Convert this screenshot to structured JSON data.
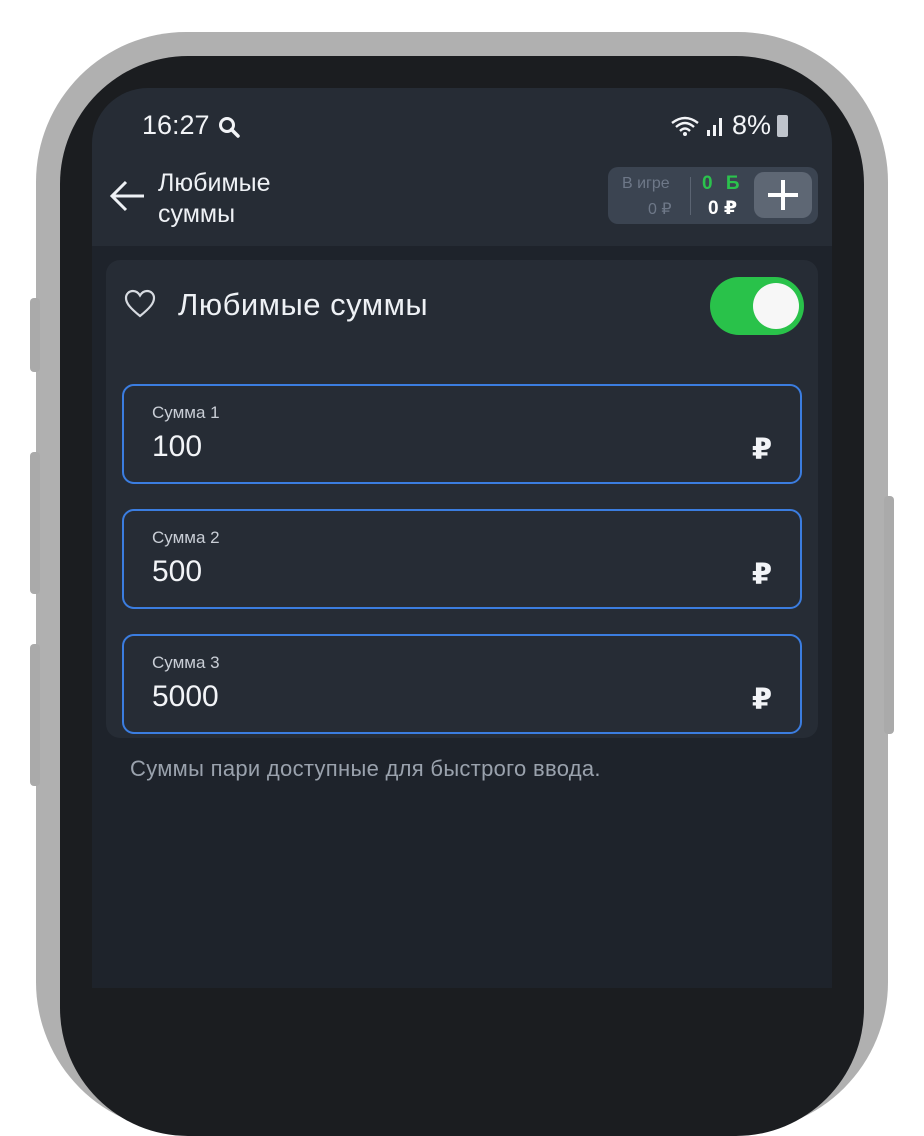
{
  "status_bar": {
    "time": "16:27",
    "battery": "8%",
    "icons": [
      "search-icon",
      "wifi-icon",
      "signal-icon",
      "battery-icon"
    ]
  },
  "app_bar": {
    "title": "Любимые суммы",
    "back_icon": "arrow-left-icon"
  },
  "balance": {
    "in_game_label": "В игре",
    "in_game_amount": "0 ₽",
    "bonus": "0 Б",
    "main_amount": "0 ₽",
    "add_icon": "plus-icon"
  },
  "favorites": {
    "title": "Любимые суммы",
    "icon": "heart-icon",
    "enabled": true,
    "fields": [
      {
        "label": "Сумма 1",
        "value": "100",
        "currency": "₽"
      },
      {
        "label": "Сумма 2",
        "value": "500",
        "currency": "₽"
      },
      {
        "label": "Сумма 3",
        "value": "5000",
        "currency": "₽"
      }
    ],
    "hint": "Суммы пари доступные для быстрого ввода."
  },
  "colors": {
    "background": "#1e232b",
    "surface": "#262c35",
    "accent_green": "#29c24a",
    "field_border": "#3b7de0"
  }
}
